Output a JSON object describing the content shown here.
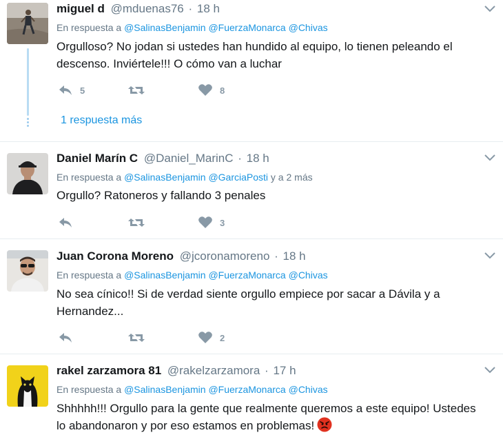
{
  "tweets": [
    {
      "fullname": "miguel d",
      "screen_name": "@mduenas76",
      "time": "18 h",
      "reply_prefix": "En respuesta a ",
      "mentions": [
        "@SalinasBenjamin",
        "@FuerzaMonarca",
        "@Chivas"
      ],
      "reply_suffix": "",
      "text_lines": [
        "Orgulloso? No jodan si ustedes han hundido al equipo, lo tienen peleando el",
        "descenso. Inviértele!!! O cómo van a luchar"
      ],
      "reply_count": "5",
      "retweet_count": "",
      "like_count": "8",
      "avatar": "runner-photo"
    },
    {
      "fullname": "Daniel Marín C",
      "screen_name": "@Daniel_MarinC",
      "time": "18 h",
      "reply_prefix": "En respuesta a ",
      "mentions": [
        "@SalinasBenjamin",
        "@GarciaPosti"
      ],
      "reply_suffix": " y a 2 más",
      "text_lines": [
        "Orgullo? Ratoneros y fallando 3 penales"
      ],
      "reply_count": "",
      "retweet_count": "",
      "like_count": "3",
      "avatar": "man-cap-photo"
    },
    {
      "fullname": "Juan Corona Moreno",
      "screen_name": "@jcoronamoreno",
      "time": "18 h",
      "reply_prefix": "En respuesta a ",
      "mentions": [
        "@SalinasBenjamin",
        "@FuerzaMonarca",
        "@Chivas"
      ],
      "reply_suffix": "",
      "text_lines": [
        "No sea cínico!! Si de verdad siente orgullo empiece por sacar a Dávila y a",
        "Hernandez..."
      ],
      "reply_count": "",
      "retweet_count": "",
      "like_count": "2",
      "avatar": "man-sunglasses-photo"
    },
    {
      "fullname": "rakel zarzamora 81",
      "screen_name": "@rakelzarzamora",
      "time": "17 h",
      "reply_prefix": "En respuesta a ",
      "mentions": [
        "@SalinasBenjamin",
        "@FuerzaMonarca",
        "@Chivas"
      ],
      "reply_suffix": "",
      "text_lines": [
        "Shhhhh!!! Orgullo para la gente que realmente queremos a este equipo! Ustedes",
        "lo abandonaron y por eso estamos en problemas!"
      ],
      "reply_count": "",
      "retweet_count": "",
      "like_count": "",
      "avatar": "cat-yellow-photo"
    }
  ],
  "thread": {
    "more_link": "1 respuesta más"
  },
  "icons": {
    "reply": "reply-icon",
    "retweet": "retweet-icon",
    "like": "heart-icon",
    "caret": "chevron-down-icon",
    "emoji": "angry-face-emoji"
  },
  "colors": {
    "link": "#1b95e0",
    "muted": "#657786",
    "action": "#8899a6",
    "divider": "#e6ecf0",
    "thread": "#b9dcf3"
  }
}
